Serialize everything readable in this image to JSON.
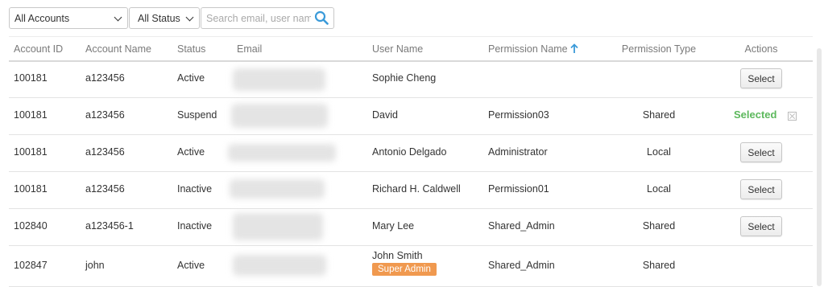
{
  "filters": {
    "account_select": "All Accounts",
    "status_select": "All Status",
    "search_placeholder": "Search email, user name"
  },
  "table": {
    "headers": {
      "account_id": "Account ID",
      "account_name": "Account Name",
      "status": "Status",
      "email": "Email",
      "user_name": "User Name",
      "permission_name": "Permission Name",
      "permission_type": "Permission Type",
      "actions": "Actions"
    },
    "rows": [
      {
        "account_id": "100181",
        "account_name": "a123456",
        "status": "Active",
        "user_name": "Sophie Cheng",
        "permission_name": "",
        "permission_type": "",
        "action": "Select"
      },
      {
        "account_id": "100181",
        "account_name": "a123456",
        "status": "Suspend",
        "user_name": "David",
        "permission_name": "Permission03",
        "permission_type": "Shared",
        "action": "Selected"
      },
      {
        "account_id": "100181",
        "account_name": "a123456",
        "status": "Active",
        "user_name": "Antonio Delgado",
        "permission_name": "Administrator",
        "permission_type": "Local",
        "action": "Select"
      },
      {
        "account_id": "100181",
        "account_name": "a123456",
        "status": "Inactive",
        "user_name": "Richard H. Caldwell",
        "permission_name": "Permission01",
        "permission_type": "Local",
        "action": "Select"
      },
      {
        "account_id": "102840",
        "account_name": "a123456-1",
        "status": "Inactive",
        "user_name": "Mary Lee",
        "permission_name": "Shared_Admin",
        "permission_type": "Shared",
        "action": "Select"
      },
      {
        "account_id": "102847",
        "account_name": "john",
        "status": "Active",
        "user_name": "John Smith",
        "badge": "Super Admin",
        "permission_name": "Shared_Admin",
        "permission_type": "Shared",
        "action": ""
      }
    ]
  },
  "colors": {
    "accent": "#3a9ad9",
    "selected": "#5cb85c",
    "badge": "#f0994f"
  }
}
